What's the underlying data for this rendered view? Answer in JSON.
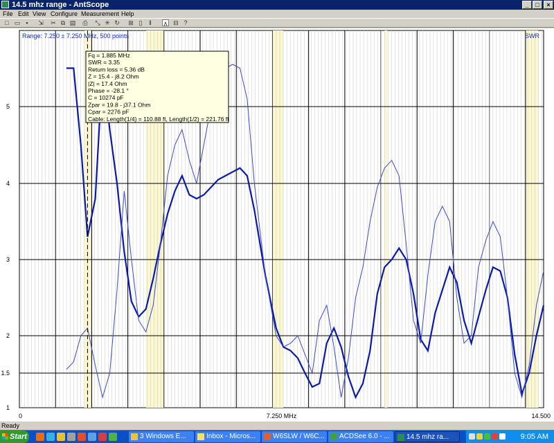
{
  "window": {
    "title": "14.5 mhz range - AntScope"
  },
  "menu": [
    "File",
    "Edit",
    "View",
    "Configure",
    "Measurement",
    "Help"
  ],
  "toolbar": [
    "new-icon",
    "open-icon",
    "save-icon",
    "import-icon",
    "cut-icon",
    "copy-icon",
    "paste-icon",
    "print-icon",
    "zoom-in-icon",
    "zoom-out-icon",
    "refresh-icon",
    "scan-icon",
    "single-sweep-icon",
    "pause-icon",
    "marker-icon",
    "limits-icon",
    "help-icon"
  ],
  "chart": {
    "range_label": "Range: 7.250 ± 7.250 MHz, 500 points",
    "series_label": "SWR",
    "cursor_info": [
      "Fq = 1.885 MHz",
      "SWR = 3.35",
      "Return loss = 5.36 dB",
      "Z = 15.4 - j8.2 Ohm",
      "|Z| = 17.4 Ohm",
      "Phase = -28.1 °",
      "C = 10274 pF",
      "Zpar = 19.8 - j37.1 Ohm",
      "Cpar = 2276 pF",
      "Cable: Length(1/4) = 110.88 ft, Length(1/2) = 221.76 ft"
    ]
  },
  "chart_data": {
    "type": "line",
    "x_ticks": [
      "0",
      "7.250 MHz",
      "14.500"
    ],
    "y_ticks": [
      "1",
      "1.5",
      "2",
      "3",
      "4",
      "5"
    ],
    "xlim": [
      0,
      14.5
    ],
    "ylim": [
      1,
      5.5
    ],
    "grid": true,
    "cursor_x": 1.885,
    "highlight_bands": [
      [
        1.8,
        2.0
      ],
      [
        3.5,
        4.0
      ],
      [
        7.0,
        7.3
      ],
      [
        10.1,
        10.15
      ],
      [
        14.0,
        14.35
      ]
    ],
    "series": [
      {
        "name": "SWR",
        "x": [
          1.3,
          1.5,
          1.7,
          1.885,
          2.1,
          2.3,
          2.5,
          2.7,
          2.9,
          3.1,
          3.3,
          3.5,
          3.7,
          3.9,
          4.1,
          4.3,
          4.5,
          4.7,
          4.9,
          5.1,
          5.3,
          5.5,
          5.7,
          5.9,
          6.1,
          6.3,
          6.5,
          6.8,
          7.1,
          7.3,
          7.5,
          7.7,
          7.9,
          8.1,
          8.3,
          8.5,
          8.7,
          8.9,
          9.1,
          9.3,
          9.5,
          9.7,
          9.9,
          10.1,
          10.3,
          10.5,
          10.7,
          10.9,
          11.1,
          11.3,
          11.5,
          11.7,
          11.9,
          12.1,
          12.3,
          12.5,
          12.7,
          12.9,
          13.1,
          13.3,
          13.5,
          13.7,
          13.9,
          14.1,
          14.3,
          14.5
        ],
        "y": [
          5.5,
          5.5,
          4.5,
          3.3,
          3.8,
          5.5,
          4.7,
          4.0,
          3.1,
          2.45,
          2.25,
          2.35,
          2.75,
          3.2,
          3.6,
          3.9,
          4.1,
          3.85,
          3.8,
          3.85,
          3.95,
          4.05,
          4.1,
          4.15,
          4.2,
          4.1,
          3.65,
          2.8,
          2.1,
          1.85,
          1.8,
          1.7,
          1.5,
          1.3,
          1.35,
          1.9,
          2.1,
          1.85,
          1.45,
          1.15,
          1.35,
          1.8,
          2.55,
          2.9,
          3.0,
          3.15,
          3.0,
          2.55,
          1.95,
          1.8,
          2.3,
          2.6,
          2.9,
          2.7,
          2.2,
          1.9,
          2.25,
          2.6,
          2.9,
          2.85,
          2.5,
          1.75,
          1.2,
          1.5,
          2.0,
          2.4
        ]
      },
      {
        "name": "",
        "x": [
          1.3,
          1.5,
          1.7,
          1.885,
          2.1,
          2.3,
          2.5,
          2.7,
          2.9,
          3.1,
          3.3,
          3.5,
          3.7,
          3.9,
          4.1,
          4.3,
          4.5,
          4.7,
          4.9,
          5.1,
          5.3,
          5.5,
          5.7,
          5.9,
          6.1,
          6.3,
          6.5,
          6.8,
          7.1,
          7.3,
          7.5,
          7.7,
          7.9,
          8.1,
          8.3,
          8.5,
          8.7,
          8.9,
          9.1,
          9.3,
          9.5,
          9.7,
          9.9,
          10.1,
          10.3,
          10.5,
          10.7,
          10.9,
          11.1,
          11.3,
          11.5,
          11.7,
          11.9,
          12.1,
          12.3,
          12.5,
          12.7,
          12.9,
          13.1,
          13.3,
          13.5,
          13.7,
          13.9,
          14.1,
          14.3,
          14.5
        ],
        "y": [
          1.55,
          1.65,
          2.0,
          2.1,
          1.6,
          1.15,
          1.5,
          2.6,
          3.9,
          3.0,
          2.2,
          2.05,
          2.4,
          3.2,
          4.1,
          4.5,
          4.7,
          4.3,
          4.0,
          4.5,
          5.0,
          5.35,
          5.5,
          5.55,
          5.5,
          5.1,
          4.0,
          2.8,
          2.0,
          1.85,
          1.9,
          2.0,
          1.75,
          1.5,
          2.2,
          2.4,
          1.85,
          1.15,
          1.7,
          2.5,
          2.9,
          3.5,
          3.95,
          4.2,
          4.3,
          4.1,
          3.2,
          2.2,
          1.9,
          2.8,
          3.5,
          3.7,
          3.5,
          2.5,
          1.9,
          2.0,
          2.9,
          3.25,
          3.5,
          3.3,
          2.5,
          1.5,
          1.15,
          1.6,
          2.4,
          2.85
        ]
      }
    ]
  },
  "status": {
    "text": "Ready"
  },
  "taskbar": {
    "start": "Start",
    "tasks": [
      "3 Windows E...",
      "Inbox - Micros...",
      "W6SLW / W6C...",
      "ACDSee 6.0 - ...",
      "14.5 mhz ra..."
    ],
    "clock": "9:05 AM"
  }
}
